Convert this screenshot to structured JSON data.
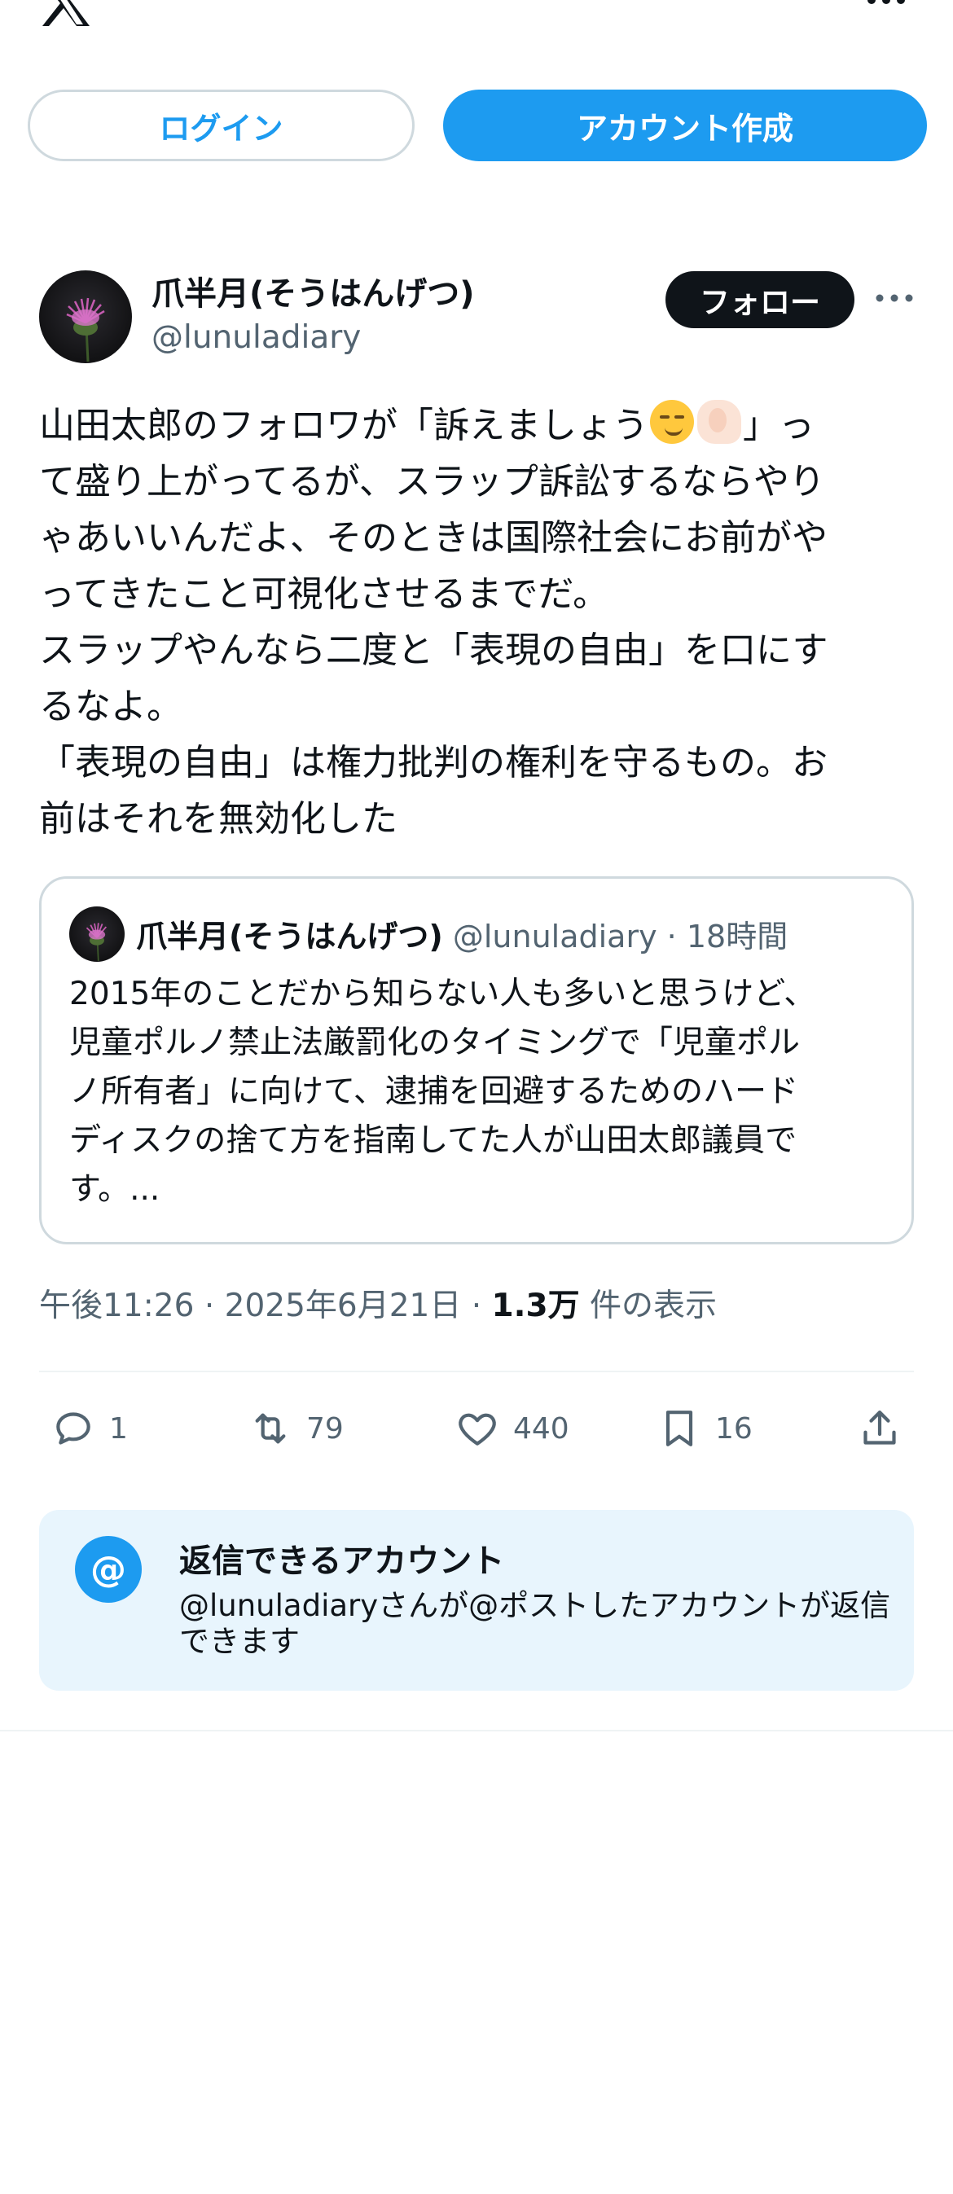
{
  "topbar": {
    "logo_icon": "x-logo-icon",
    "more_icon": "more-horizontal-icon"
  },
  "auth": {
    "login_label": "ログイン",
    "signup_label": "アカウント作成"
  },
  "post": {
    "display_name": "爪半月(そうはんげつ)",
    "handle": "@lunuladiary",
    "follow_label": "フォロー",
    "body_lines": [
      [
        "山田太郎のフォロワが「訴えましょう",
        "」っ"
      ],
      "て盛り上がってるが、スラップ訴訟するならやり",
      "ゃあいいんだよ、そのときは国際社会にお前がや",
      "ってきたこと可視化させるまでだ。",
      "スラップやんなら二度と「表現の自由」を口にす",
      "るなよ。",
      "「表現の自由」は権力批判の権利を守るもの。お",
      "前はそれを無効化した"
    ],
    "emojis": [
      "smirking-face-emoji",
      "flexed-biceps-emoji"
    ]
  },
  "quote": {
    "display_name": "爪半月(そうはんげつ)",
    "handle": "@lunuladiary",
    "separator": "·",
    "time": "18時間",
    "text_lines": [
      "2015年のことだから知らない人も多いと思うけど、",
      "児童ポルノ禁止法厳罰化のタイミングで「児童ポル",
      "ノ所有者」に向けて、逮捕を回避するためのハード",
      "ディスクの捨て方を指南してた人が山田太郎議員で",
      "す。..."
    ]
  },
  "meta": {
    "time": "午後11:26",
    "sep": "·",
    "date": "2025年6月21日",
    "views_count": "1.3万",
    "views_label": "件の表示"
  },
  "actions": {
    "replies": "1",
    "retweets": "79",
    "likes": "440",
    "bookmarks": "16"
  },
  "reply_settings": {
    "icon_text": "@",
    "title": "返信できるアカウント",
    "description": "@lunuladiaryさんが@ポストしたアカウントが返信できます"
  },
  "colors": {
    "accent": "#1d9bf0",
    "text": "#0f1419",
    "muted": "#536471",
    "reply_bg": "#e8f5fd"
  }
}
